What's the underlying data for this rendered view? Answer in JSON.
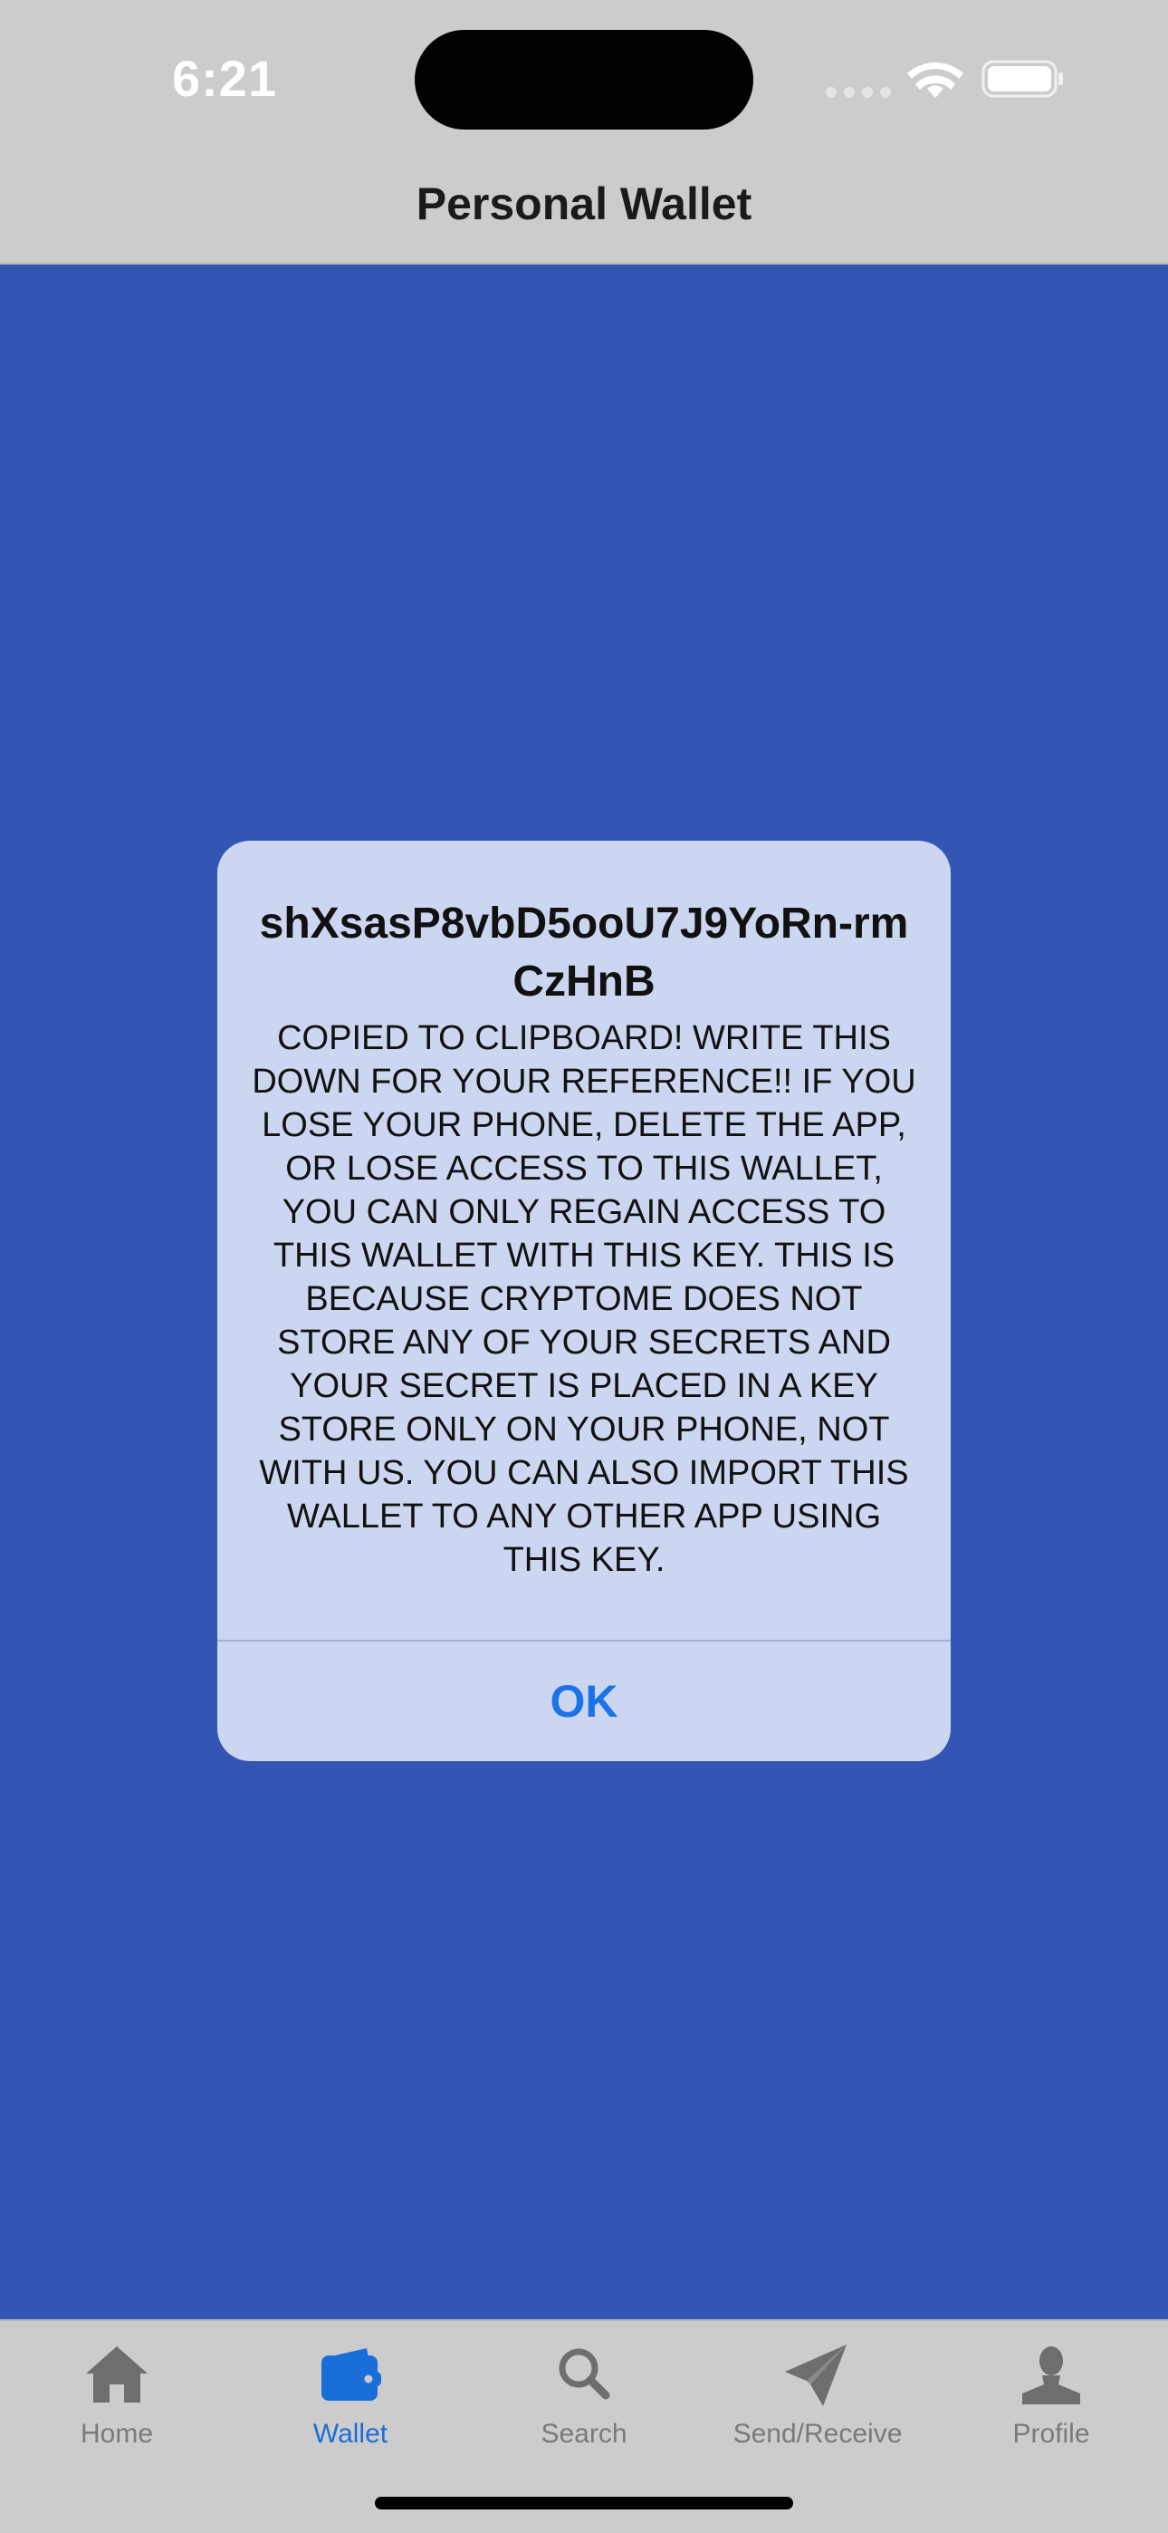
{
  "status_bar": {
    "time": "6:21"
  },
  "nav": {
    "title": "Personal Wallet"
  },
  "alert": {
    "title": "shXsasP8vbD5ooU7J9YoRn-rmCzHnB",
    "message": "COPIED TO CLIPBOARD! WRITE THIS DOWN FOR YOUR REFERENCE!! IF YOU LOSE YOUR PHONE, DELETE THE APP, OR LOSE ACCESS TO THIS WALLET, YOU CAN ONLY REGAIN ACCESS TO THIS WALLET WITH THIS KEY. THIS IS BECAUSE CRYPTOME DOES NOT STORE ANY OF YOUR SECRETS AND YOUR SECRET IS PLACED IN A KEY STORE ONLY ON YOUR PHONE, NOT WITH US. YOU CAN ALSO IMPORT THIS WALLET TO ANY OTHER APP USING THIS KEY.",
    "ok_label": "OK"
  },
  "tab_bar": {
    "items": [
      {
        "label": "Home",
        "icon": "home-icon",
        "active": false
      },
      {
        "label": "Wallet",
        "icon": "wallet-icon",
        "active": true
      },
      {
        "label": "Search",
        "icon": "search-icon",
        "active": false
      },
      {
        "label": "Send/Receive",
        "icon": "paper-plane-icon",
        "active": false
      },
      {
        "label": "Profile",
        "icon": "person-icon",
        "active": false
      }
    ]
  },
  "colors": {
    "background": "#3555b5",
    "bars": "#cccccc",
    "alert_bg": "#cdd6f1",
    "accent": "#1a73e8",
    "tab_active": "#1a6ed8",
    "tab_inactive": "#7a7a7a"
  }
}
